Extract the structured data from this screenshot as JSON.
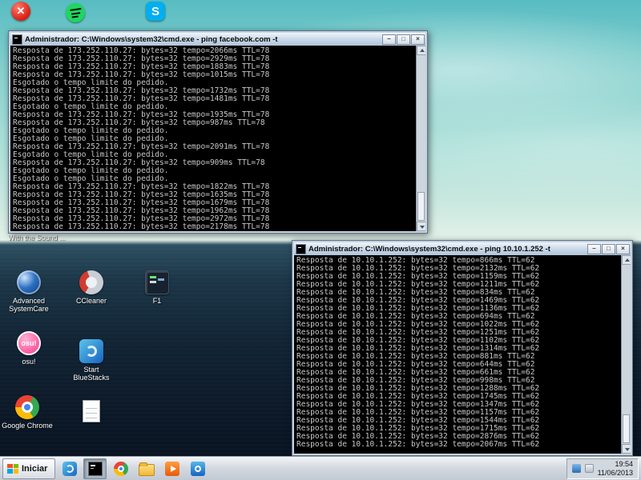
{
  "desktop": {
    "overlay_text": "With the Sound ...",
    "top_shortcuts": [
      {
        "name": "blocked-app",
        "glyph": "✕",
        "label": ""
      },
      {
        "name": "spotify",
        "label": ""
      },
      {
        "name": "skype",
        "letter": "S",
        "label": ""
      }
    ],
    "shortcuts": [
      {
        "label": "Advanced SystemCare"
      },
      {
        "label": "CCleaner"
      },
      {
        "label": "F1"
      },
      {
        "label": "osu!",
        "icon_text": "osu!"
      },
      {
        "label": "Start BlueStacks"
      },
      {
        "label": "Google Chrome"
      },
      {
        "label": ""
      }
    ]
  },
  "windows": {
    "controls": {
      "minimize": "–",
      "maximize": "□",
      "close": "×"
    },
    "ping_facebook": {
      "title": "Administrador: C:\\Windows\\system32\\cmd.exe - ping facebook.com -t",
      "lines": [
        "Resposta de 173.252.110.27: bytes=32 tempo=2066ms TTL=78",
        "Resposta de 173.252.110.27: bytes=32 tempo=2929ms TTL=78",
        "Resposta de 173.252.110.27: bytes=32 tempo=1883ms TTL=78",
        "Resposta de 173.252.110.27: bytes=32 tempo=1015ms TTL=78",
        "Esgotado o tempo limite do pedido.",
        "Resposta de 173.252.110.27: bytes=32 tempo=1732ms TTL=78",
        "Resposta de 173.252.110.27: bytes=32 tempo=1481ms TTL=78",
        "Esgotado o tempo limite do pedido.",
        "Resposta de 173.252.110.27: bytes=32 tempo=1935ms TTL=78",
        "Resposta de 173.252.110.27: bytes=32 tempo=987ms TTL=78",
        "Esgotado o tempo limite do pedido.",
        "Esgotado o tempo limite do pedido.",
        "Resposta de 173.252.110.27: bytes=32 tempo=2091ms TTL=78",
        "Esgotado o tempo limite do pedido.",
        "Resposta de 173.252.110.27: bytes=32 tempo=909ms TTL=78",
        "Esgotado o tempo limite do pedido.",
        "Esgotado o tempo limite do pedido.",
        "Resposta de 173.252.110.27: bytes=32 tempo=1822ms TTL=78",
        "Resposta de 173.252.110.27: bytes=32 tempo=1635ms TTL=78",
        "Resposta de 173.252.110.27: bytes=32 tempo=1679ms TTL=78",
        "Resposta de 173.252.110.27: bytes=32 tempo=1962ms TTL=78",
        "Resposta de 173.252.110.27: bytes=32 tempo=2972ms TTL=78",
        "Resposta de 173.252.110.27: bytes=32 tempo=2178ms TTL=78"
      ]
    },
    "ping_local": {
      "title": "Administrador: C:\\Windows\\system32\\cmd.exe - ping 10.10.1.252 -t",
      "lines": [
        "Resposta de 10.10.1.252: bytes=32 tempo=866ms TTL=62",
        "Resposta de 10.10.1.252: bytes=32 tempo=2132ms TTL=62",
        "Resposta de 10.10.1.252: bytes=32 tempo=1159ms TTL=62",
        "Resposta de 10.10.1.252: bytes=32 tempo=1211ms TTL=62",
        "Resposta de 10.10.1.252: bytes=32 tempo=834ms TTL=62",
        "Resposta de 10.10.1.252: bytes=32 tempo=1469ms TTL=62",
        "Resposta de 10.10.1.252: bytes=32 tempo=1136ms TTL=62",
        "Resposta de 10.10.1.252: bytes=32 tempo=694ms TTL=62",
        "Resposta de 10.10.1.252: bytes=32 tempo=1022ms TTL=62",
        "Resposta de 10.10.1.252: bytes=32 tempo=1251ms TTL=62",
        "Resposta de 10.10.1.252: bytes=32 tempo=1102ms TTL=62",
        "Resposta de 10.10.1.252: bytes=32 tempo=1314ms TTL=62",
        "Resposta de 10.10.1.252: bytes=32 tempo=881ms TTL=62",
        "Resposta de 10.10.1.252: bytes=32 tempo=644ms TTL=62",
        "Resposta de 10.10.1.252: bytes=32 tempo=661ms TTL=62",
        "Resposta de 10.10.1.252: bytes=32 tempo=998ms TTL=62",
        "Resposta de 10.10.1.252: bytes=32 tempo=1288ms TTL=62",
        "Resposta de 10.10.1.252: bytes=32 tempo=1745ms TTL=62",
        "Resposta de 10.10.1.252: bytes=32 tempo=1347ms TTL=62",
        "Resposta de 10.10.1.252: bytes=32 tempo=1157ms TTL=62",
        "Resposta de 10.10.1.252: bytes=32 tempo=1544ms TTL=62",
        "Resposta de 10.10.1.252: bytes=32 tempo=1715ms TTL=62",
        "Resposta de 10.10.1.252: bytes=32 tempo=2876ms TTL=62",
        "Resposta de 10.10.1.252: bytes=32 tempo=2067ms TTL=62"
      ]
    }
  },
  "taskbar": {
    "start_label": "Iniciar",
    "tray": {
      "time": "19:54",
      "date": "11/06/2013"
    }
  }
}
